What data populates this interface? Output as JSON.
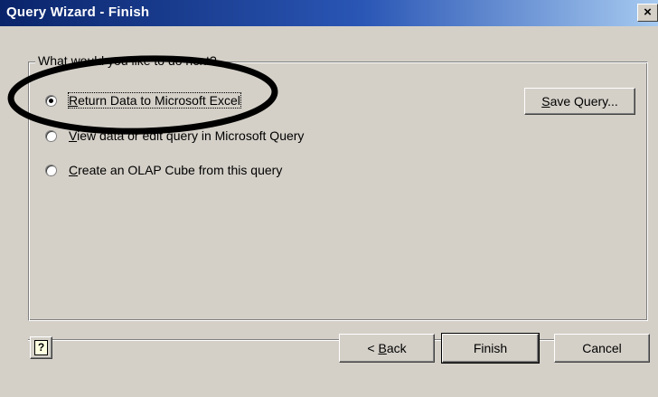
{
  "window": {
    "title": "Query Wizard - Finish",
    "close_glyph": "×"
  },
  "group": {
    "legend": "What would you like to do next?"
  },
  "options": [
    {
      "pre": "",
      "accel": "R",
      "post": "eturn Data to Microsoft Excel",
      "checked": true
    },
    {
      "pre": "",
      "accel": "V",
      "post": "iew data or edit query in Microsoft Query",
      "checked": false
    },
    {
      "pre": "",
      "accel": "C",
      "post": "reate an OLAP Cube from this query",
      "checked": false
    }
  ],
  "buttons": {
    "save_query": {
      "accel": "S",
      "post": "ave Query..."
    },
    "back": {
      "pre": "< ",
      "accel": "B",
      "post": "ack"
    },
    "finish": "Finish",
    "cancel": "Cancel",
    "help_glyph": "?"
  },
  "colors": {
    "dialog_bg": "#d4d0c8",
    "title_start": "#0a246a",
    "title_end": "#a6caf0",
    "annotation_stroke": "#000000"
  }
}
